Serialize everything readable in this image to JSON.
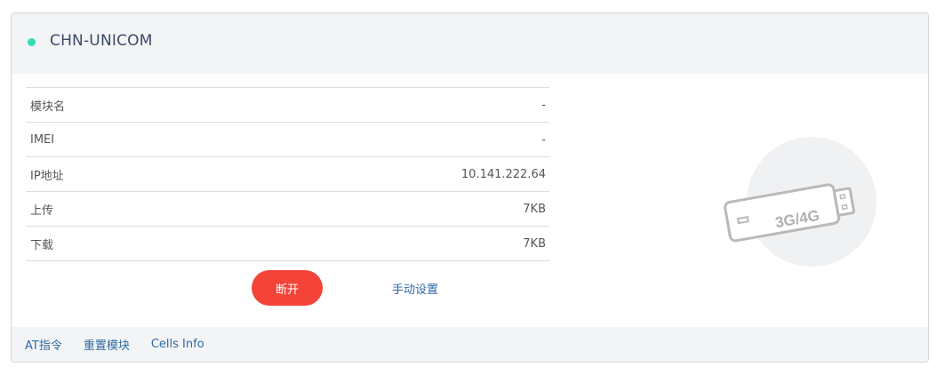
{
  "header": {
    "title": "CHN-UNICOM",
    "status_color": "#2fe0b0"
  },
  "info_rows": [
    {
      "label": "模块名",
      "value": "-"
    },
    {
      "label": "IMEI",
      "value": "-"
    },
    {
      "label": "IP地址",
      "value": "10.141.222.64"
    },
    {
      "label": "上传",
      "value": "7KB"
    },
    {
      "label": "下载",
      "value": "7KB"
    }
  ],
  "actions": {
    "disconnect_label": "断开",
    "manual_settings_label": "手动设置"
  },
  "footer": {
    "links": [
      "AT指令",
      "重置模块",
      "Cells Info"
    ]
  },
  "illustration": {
    "icon": "usb-modem-icon",
    "label": "3G/4G"
  },
  "colors": {
    "accent_red": "#f4443a",
    "link_blue": "#2e6aa3",
    "header_bg": "#f3f4f6"
  }
}
